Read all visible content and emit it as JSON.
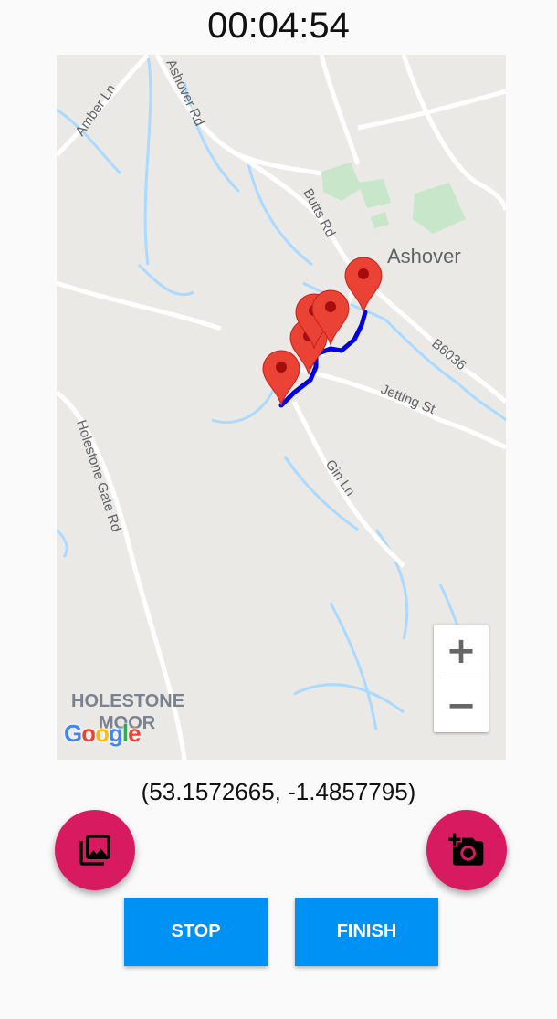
{
  "timer": "00:04:54",
  "map": {
    "labels": {
      "amber_ln": "Amber Ln",
      "ashover_rd": "Ashover Rd",
      "butts_rd": "Butts Rd",
      "ashover": "Ashover",
      "b6036": "B6036",
      "jetting_st": "Jetting St",
      "gin_ln": "Gin Ln",
      "holestone_gate_rd": "Holestone Gate Rd",
      "holestone": "HOLESTONE",
      "moor": "MOOR"
    },
    "zoom_in_label": "+",
    "zoom_out_label": "−",
    "route_color": "#0000e0",
    "marker_color": "#ea4335",
    "marker_count": 5
  },
  "coordinates": "(53.1572665, -1.4857795)",
  "buttons": {
    "stop": "STOP",
    "finish": "FINISH"
  },
  "icons": {
    "gallery": "photo-library-icon",
    "camera": "add-a-photo-icon"
  },
  "accent_fab": "#d81b60",
  "accent_button": "#0091f5"
}
